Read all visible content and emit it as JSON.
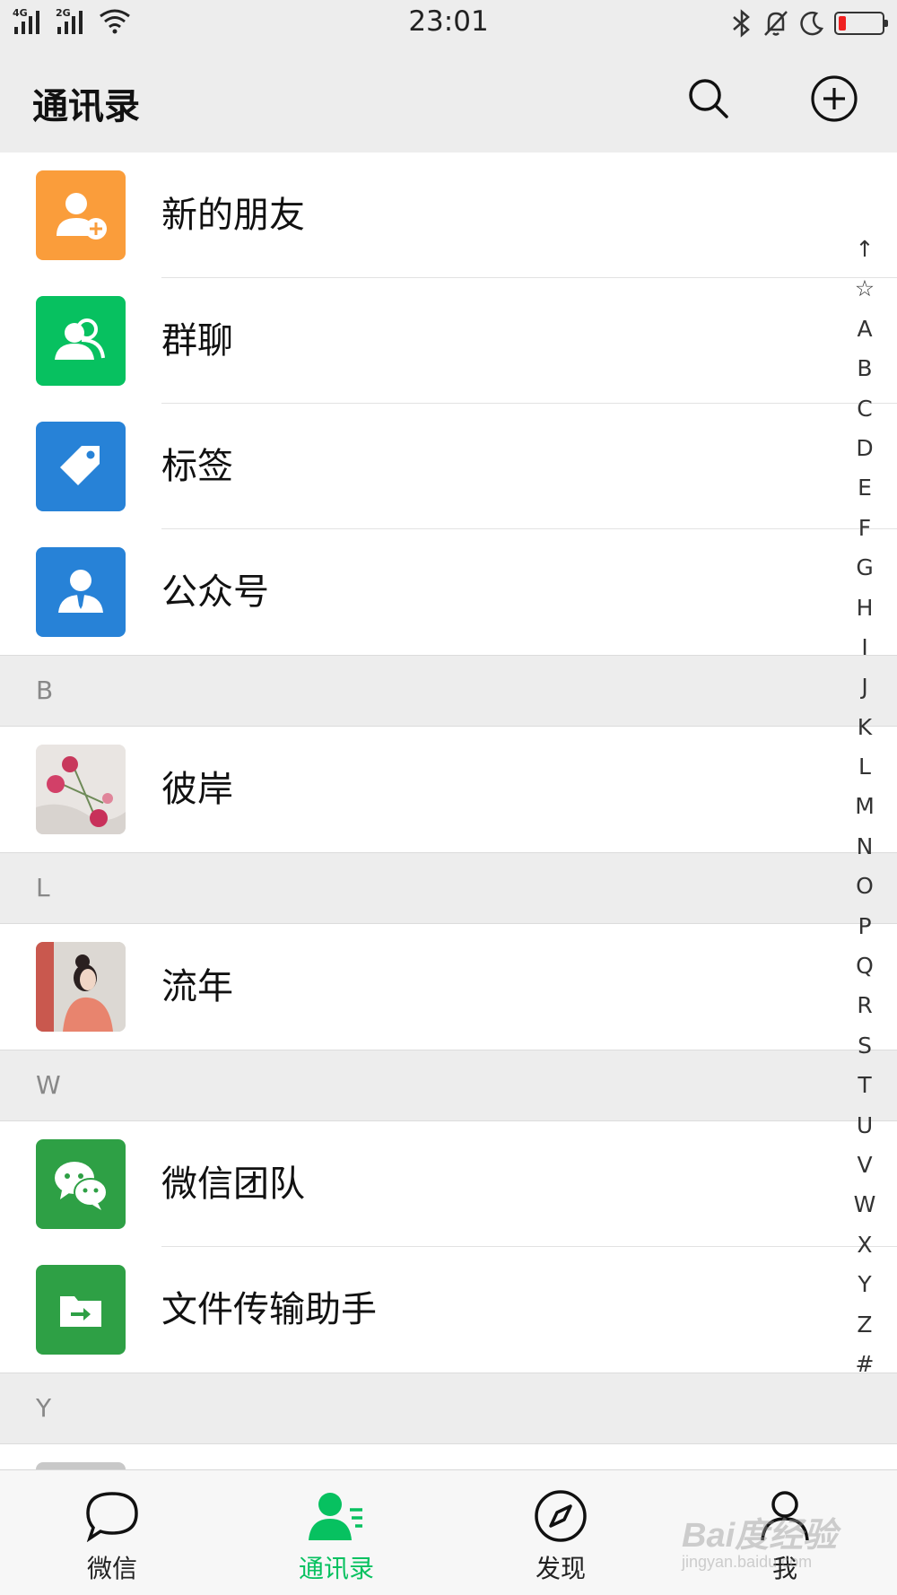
{
  "status_bar": {
    "time": "23:01",
    "network_1": "4G",
    "network_2": "2G"
  },
  "header": {
    "title": "通讯录"
  },
  "contacts": {
    "fixed": [
      {
        "label": "新的朋友",
        "icon": "add-friend-icon",
        "color": "#fa9d3b"
      },
      {
        "label": "群聊",
        "icon": "group-chat-icon",
        "color": "#07c160"
      },
      {
        "label": "标签",
        "icon": "tag-icon",
        "color": "#2782d7"
      },
      {
        "label": "公众号",
        "icon": "official-account-icon",
        "color": "#2782d7"
      }
    ],
    "sections": [
      {
        "letter": "B",
        "items": [
          {
            "label": "彼岸",
            "icon": "flower-photo-avatar"
          }
        ]
      },
      {
        "letter": "L",
        "items": [
          {
            "label": "流年",
            "icon": "girl-photo-avatar"
          }
        ]
      },
      {
        "letter": "W",
        "items": [
          {
            "label": "微信团队",
            "icon": "wechat-logo-icon",
            "color": "#2ea045"
          },
          {
            "label": "文件传输助手",
            "icon": "file-transfer-icon",
            "color": "#2ea045"
          }
        ]
      },
      {
        "letter": "Y",
        "items": []
      }
    ]
  },
  "index_bar": [
    "↑",
    "☆",
    "A",
    "B",
    "C",
    "D",
    "E",
    "F",
    "G",
    "H",
    "I",
    "J",
    "K",
    "L",
    "M",
    "N",
    "O",
    "P",
    "Q",
    "R",
    "S",
    "T",
    "U",
    "V",
    "W",
    "X",
    "Y",
    "Z",
    "#"
  ],
  "tabs": [
    {
      "label": "微信",
      "icon": "chat-bubble-icon",
      "active": false
    },
    {
      "label": "通讯录",
      "icon": "contacts-icon",
      "active": true
    },
    {
      "label": "发现",
      "icon": "compass-icon",
      "active": false
    },
    {
      "label": "我",
      "icon": "profile-icon",
      "active": false
    }
  ],
  "watermark": {
    "line1": "Bai度经验",
    "line2": "jingyan.baidu.com"
  },
  "colors": {
    "accent_green": "#07c160",
    "background_gray": "#ededed",
    "battery_low": "#f02020"
  }
}
